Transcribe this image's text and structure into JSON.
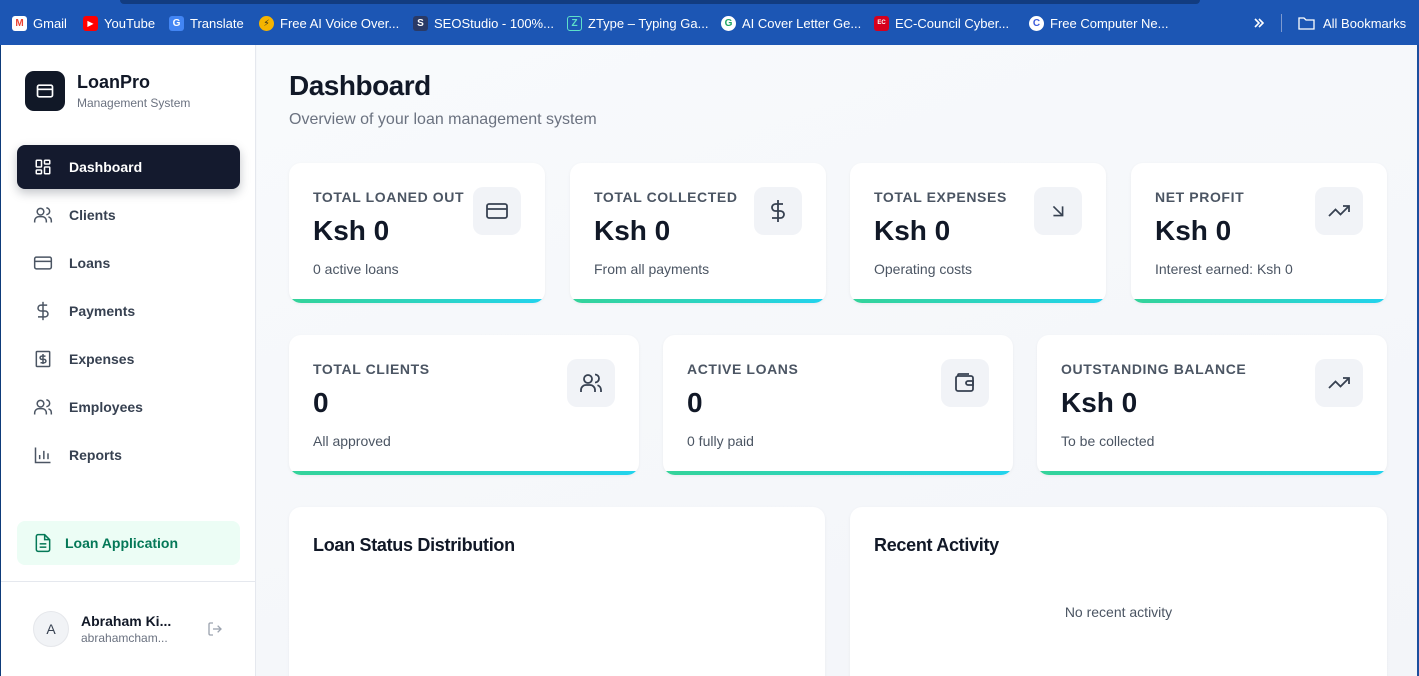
{
  "bookmarks": {
    "items": [
      {
        "label": "Gmail",
        "color": "#ea4335",
        "glyph": "M"
      },
      {
        "label": "YouTube",
        "color": "#ff0000",
        "glyph": "▶"
      },
      {
        "label": "Translate",
        "color": "#4285f4",
        "glyph": "G"
      },
      {
        "label": "Free AI Voice Over...",
        "color": "#f5b400",
        "glyph": "⚡"
      },
      {
        "label": "SEOStudio - 100%...",
        "color": "#2a3a66",
        "glyph": "S"
      },
      {
        "label": "ZType – Typing Ga...",
        "color": "#1c56b4",
        "glyph": "Z"
      },
      {
        "label": "AI Cover Letter Ge...",
        "color": "#1fa463",
        "glyph": "G"
      },
      {
        "label": "EC-Council Cyber...",
        "color": "#d6001c",
        "glyph": "EC"
      },
      {
        "label": "Free Computer Ne...",
        "color": "#3b5bdb",
        "glyph": "C"
      }
    ],
    "more_icon": "double-chevron-icon",
    "all_bookmarks_label": "All Bookmarks"
  },
  "sidebar": {
    "brand_title": "LoanPro",
    "brand_subtitle": "Management System",
    "items": [
      {
        "label": "Dashboard",
        "icon": "dashboard-icon",
        "active": true
      },
      {
        "label": "Clients",
        "icon": "users-icon",
        "active": false
      },
      {
        "label": "Loans",
        "icon": "credit-card-icon",
        "active": false
      },
      {
        "label": "Payments",
        "icon": "dollar-icon",
        "active": false
      },
      {
        "label": "Expenses",
        "icon": "receipt-icon",
        "active": false
      },
      {
        "label": "Employees",
        "icon": "employees-icon",
        "active": false
      },
      {
        "label": "Reports",
        "icon": "bar-chart-icon",
        "active": false
      }
    ],
    "loan_application_label": "Loan Application",
    "user": {
      "initial": "A",
      "name": "Abraham Ki...",
      "email": "abrahamcham..."
    }
  },
  "main": {
    "title": "Dashboard",
    "subtitle": "Overview of your loan management system",
    "stats_row1": [
      {
        "label": "TOTAL LOANED OUT",
        "value": "Ksh 0",
        "sub": "0 active loans",
        "icon": "credit-card-icon"
      },
      {
        "label": "TOTAL COLLECTED",
        "value": "Ksh 0",
        "sub": "From all payments",
        "icon": "dollar-icon"
      },
      {
        "label": "TOTAL EXPENSES",
        "value": "Ksh 0",
        "sub": "Operating costs",
        "icon": "arrow-down-right-icon"
      },
      {
        "label": "NET PROFIT",
        "value": "Ksh 0",
        "sub": "Interest earned: Ksh 0",
        "icon": "trending-up-icon"
      }
    ],
    "stats_row2": [
      {
        "label": "TOTAL CLIENTS",
        "value": "0",
        "sub": "All approved",
        "icon": "users-icon"
      },
      {
        "label": "ACTIVE LOANS",
        "value": "0",
        "sub": "0 fully paid",
        "icon": "wallet-icon"
      },
      {
        "label": "OUTSTANDING BALANCE",
        "value": "Ksh 0",
        "sub": "To be collected",
        "icon": "trending-up-icon"
      }
    ],
    "loan_status_title": "Loan Status Distribution",
    "recent_activity_title": "Recent Activity",
    "recent_activity_empty": "No recent activity"
  },
  "colors": {
    "accent_dark": "#141a2e",
    "accent_green": "#047857",
    "bar_gradient_start": "#34d399",
    "bar_gradient_end": "#22d3ee"
  }
}
